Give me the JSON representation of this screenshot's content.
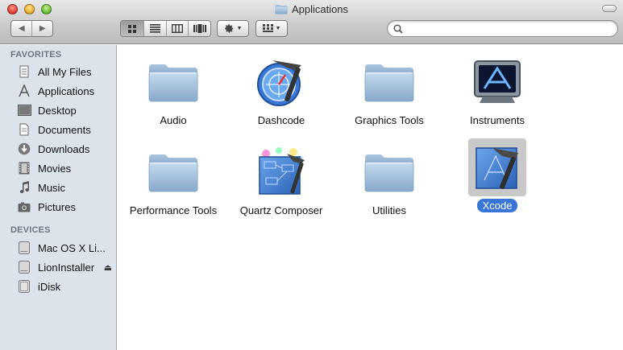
{
  "window": {
    "title": "Applications"
  },
  "toolbar": {
    "back_glyph": "◀",
    "forward_glyph": "▶",
    "view_modes": [
      "icon-view",
      "list-view",
      "column-view",
      "cover-flow-view"
    ],
    "active_view": "icon-view",
    "search_placeholder": ""
  },
  "sidebar": {
    "favorites_header": "FAVORITES",
    "favorites": [
      {
        "label": "All My Files",
        "icon": "all-files-icon"
      },
      {
        "label": "Applications",
        "icon": "applications-icon"
      },
      {
        "label": "Desktop",
        "icon": "desktop-icon"
      },
      {
        "label": "Documents",
        "icon": "documents-icon"
      },
      {
        "label": "Downloads",
        "icon": "downloads-icon"
      },
      {
        "label": "Movies",
        "icon": "movies-icon"
      },
      {
        "label": "Music",
        "icon": "music-icon"
      },
      {
        "label": "Pictures",
        "icon": "pictures-icon"
      }
    ],
    "devices_header": "DEVICES",
    "devices": [
      {
        "label": "Mac OS X Li...",
        "icon": "hard-drive-icon"
      },
      {
        "label": "LionInstaller",
        "icon": "hard-drive-icon",
        "eject": "⏏"
      },
      {
        "label": "iDisk",
        "icon": "idisk-icon"
      }
    ]
  },
  "files": [
    {
      "name": "Audio",
      "icon": "folder-icon"
    },
    {
      "name": "Dashcode",
      "icon": "dashcode-icon"
    },
    {
      "name": "Graphics Tools",
      "icon": "folder-icon"
    },
    {
      "name": "Instruments",
      "icon": "instruments-icon"
    },
    {
      "name": "Performance Tools",
      "icon": "folder-icon"
    },
    {
      "name": "Quartz Composer",
      "icon": "quartz-composer-icon"
    },
    {
      "name": "Utilities",
      "icon": "folder-icon"
    },
    {
      "name": "Xcode",
      "icon": "xcode-icon",
      "selected": true
    }
  ],
  "colors": {
    "sidebar_bg": "#dde3ea",
    "selection": "#3875d7",
    "folder": "#9fbcd8"
  }
}
